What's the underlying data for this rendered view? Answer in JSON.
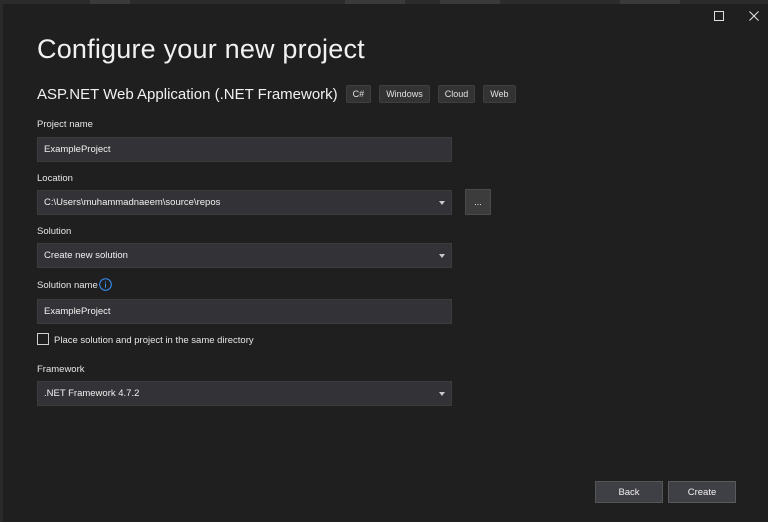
{
  "window": {
    "title": "Configure your new project",
    "maximize_icon": "maximize-icon",
    "close_icon": "close-icon"
  },
  "template": {
    "name": "ASP.NET Web Application (.NET Framework)",
    "tags": [
      "C#",
      "Windows",
      "Cloud",
      "Web"
    ]
  },
  "form": {
    "project_name": {
      "label": "Project name",
      "value": "ExampleProject"
    },
    "location": {
      "label": "Location",
      "value": "C:\\Users\\muhammadnaeem\\source\\repos",
      "browse_label": "..."
    },
    "solution": {
      "label": "Solution",
      "value": "Create new solution"
    },
    "solution_name": {
      "label": "Solution name",
      "value": "ExampleProject",
      "info_icon": "info-icon"
    },
    "same_directory": {
      "label": "Place solution and project in the same directory",
      "checked": false
    },
    "framework": {
      "label": "Framework",
      "value": ".NET Framework 4.7.2"
    }
  },
  "buttons": {
    "back": "Back",
    "create": "Create"
  },
  "colors": {
    "background": "#1f1f1f",
    "field": "#333337",
    "button": "#3f3f46",
    "info_accent": "#3794ff"
  }
}
